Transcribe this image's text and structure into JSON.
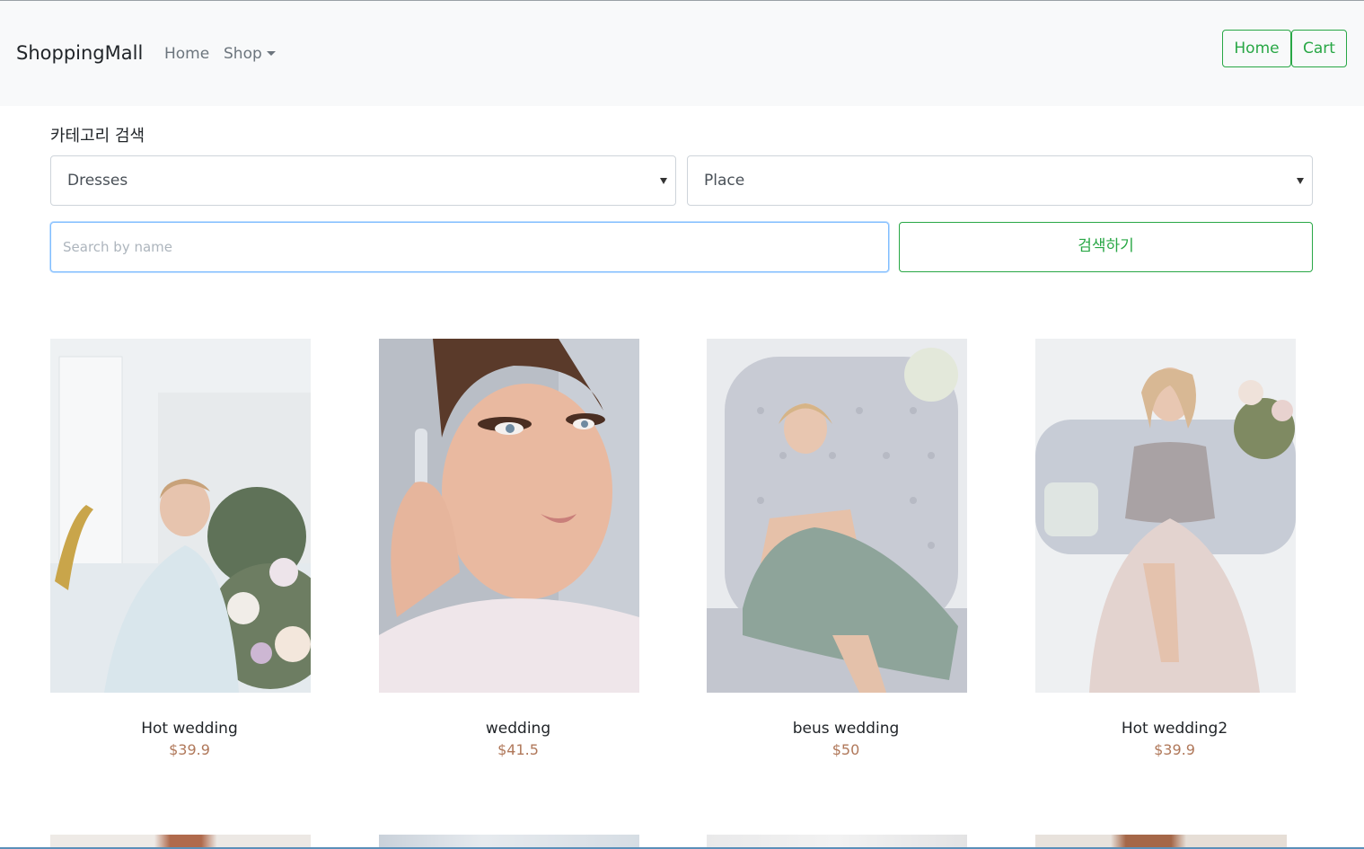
{
  "navbar": {
    "brand": "ShoppingMall",
    "links": {
      "home": "Home",
      "shop": "Shop"
    },
    "buttons": {
      "home": "Home",
      "cart": "Cart"
    }
  },
  "category_search": {
    "title": "카테고리 검색",
    "select_category": "Dresses",
    "select_place": "Place",
    "search_placeholder": "Search by name",
    "search_button": "검색하기"
  },
  "products": [
    {
      "name": "Hot wedding",
      "price": "$39.9"
    },
    {
      "name": "wedding",
      "price": "$41.5"
    },
    {
      "name": "beus wedding",
      "price": "$50"
    },
    {
      "name": "Hot wedding2",
      "price": "$39.9"
    }
  ],
  "colors": {
    "accent": "#28a745",
    "price": "#b0785a",
    "navbar_bg": "#f8f9fa"
  }
}
